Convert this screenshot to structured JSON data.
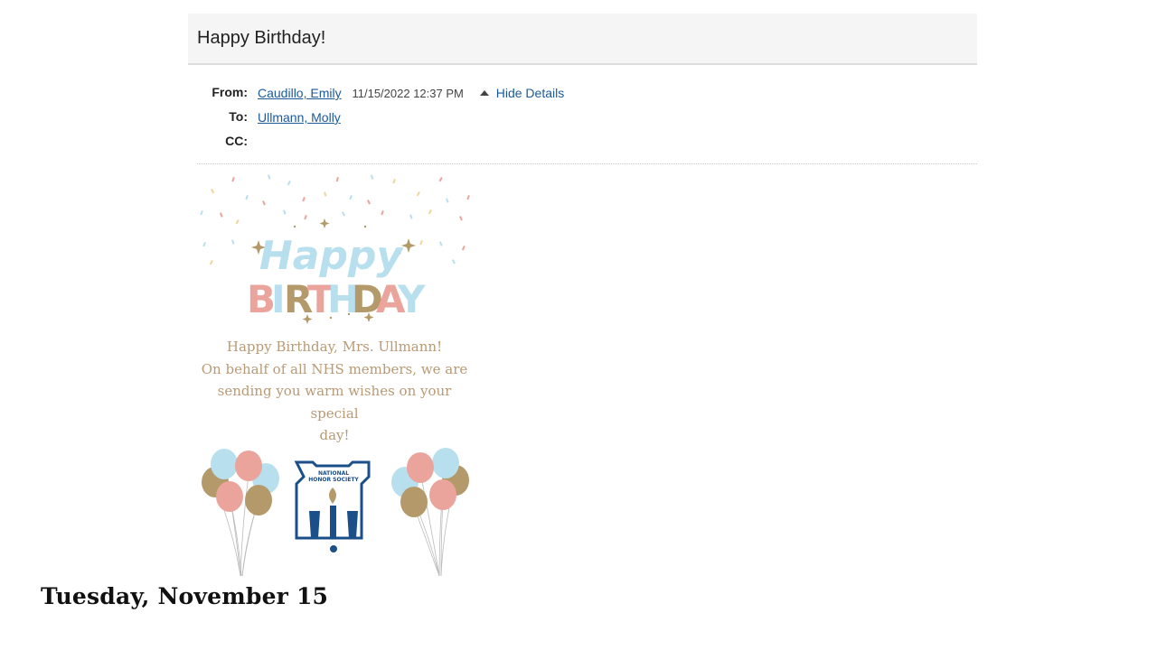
{
  "email": {
    "subject": "Happy Birthday!",
    "from_label": "From:",
    "from_name": "Caudillo, Emily",
    "date": "11/15/2022 12:37 PM",
    "hide_details": "Hide Details",
    "to_label": "To:",
    "to_name": "Ullmann, Molly",
    "cc_label": "CC:"
  },
  "card": {
    "happy": "Happy",
    "birthday_letters": [
      "B",
      "I",
      "R",
      "T",
      "H",
      "D",
      "A",
      "Y"
    ],
    "message_lines": [
      "Happy Birthday, Mrs. Ullmann!",
      "On behalf of all NHS members, we are",
      "sending you warm wishes on your special",
      "day!"
    ],
    "logo_line1": "NATIONAL",
    "logo_line2": "HONOR SOCIETY",
    "colors": {
      "pink": "#eba49c",
      "blue": "#b7dfee",
      "gold": "#b49a6a",
      "navy": "#1a4f8a"
    }
  },
  "footer": {
    "date": "Tuesday, November 15"
  }
}
